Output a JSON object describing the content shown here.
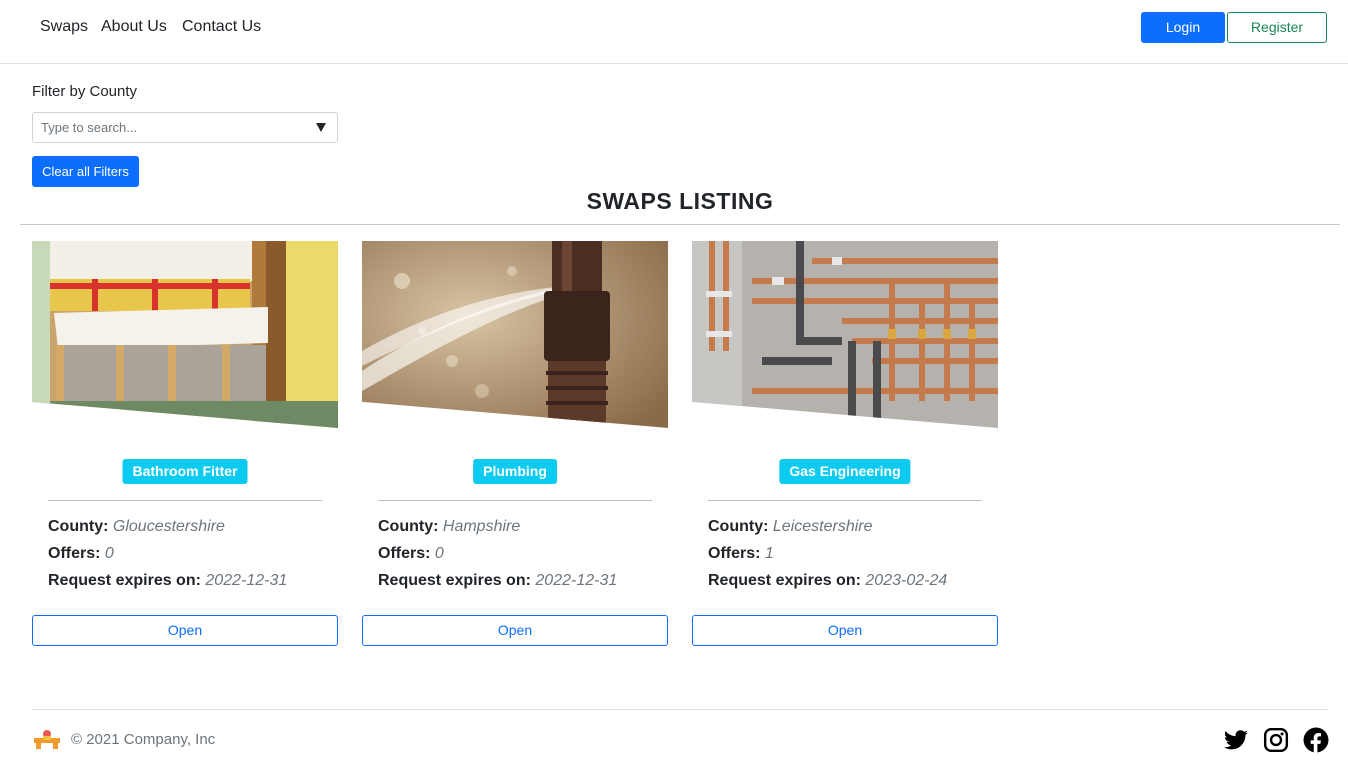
{
  "nav": {
    "links": [
      "Swaps",
      "About Us",
      "Contact Us"
    ],
    "login": "Login",
    "register": "Register"
  },
  "filter": {
    "label": "Filter by County",
    "placeholder": "Type to search...",
    "clear": "Clear all Filters"
  },
  "title": "SWAPS LISTING",
  "labels": {
    "county": "County:",
    "offers": "Offers:",
    "expires": "Request expires on:",
    "open": "Open"
  },
  "cards": [
    {
      "category": "Bathroom Fitter",
      "county": "Gloucestershire",
      "offers": "0",
      "expires": "2022-12-31",
      "image": "bathroom-image"
    },
    {
      "category": "Plumbing",
      "county": "Hampshire",
      "offers": "0",
      "expires": "2022-12-31",
      "image": "leaking-pipe-image"
    },
    {
      "category": "Gas Engineering",
      "county": "Leicestershire",
      "offers": "1",
      "expires": "2023-02-24",
      "image": "copper-pipes-image"
    }
  ],
  "footer": {
    "copyright": "© 2021 Company, Inc",
    "icons": [
      "twitter-icon",
      "instagram-icon",
      "facebook-icon"
    ]
  },
  "colors": {
    "primary": "#0d6efd",
    "success": "#198754",
    "info": "#0dcaf0"
  }
}
